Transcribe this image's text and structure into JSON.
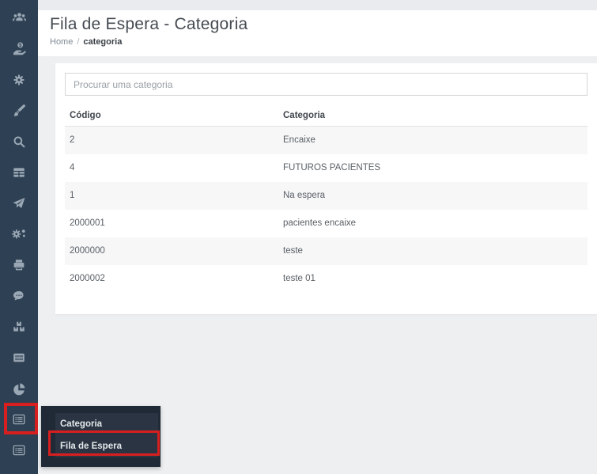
{
  "header": {
    "title": "Fila de Espera - Categoria",
    "breadcrumb": {
      "home": "Home",
      "separator": "/",
      "current": "categoria"
    }
  },
  "search": {
    "placeholder": "Procurar uma categoria",
    "value": ""
  },
  "table": {
    "columns": {
      "codigo": "Código",
      "categoria": "Categoria"
    },
    "rows": [
      {
        "codigo": "2",
        "categoria": "Encaixe"
      },
      {
        "codigo": "4",
        "categoria": "FUTUROS PACIENTES"
      },
      {
        "codigo": "1",
        "categoria": "Na espera"
      },
      {
        "codigo": "2000001",
        "categoria": "pacientes encaixe"
      },
      {
        "codigo": "2000000",
        "categoria": "teste"
      },
      {
        "codigo": "2000002",
        "categoria": "teste 01"
      }
    ]
  },
  "sidebar": {
    "items": [
      {
        "icon": "users-icon"
      },
      {
        "icon": "hand-holding-dollar-icon"
      },
      {
        "icon": "gear-icon"
      },
      {
        "icon": "paintbrush-icon"
      },
      {
        "icon": "search-icon"
      },
      {
        "icon": "table-icon"
      },
      {
        "icon": "paper-plane-icon"
      },
      {
        "icon": "gears-icon"
      },
      {
        "icon": "printer-icon"
      },
      {
        "icon": "chat-bubble-icon"
      },
      {
        "icon": "boxes-icon"
      },
      {
        "icon": "calendar-grid-icon"
      },
      {
        "icon": "pie-chart-icon"
      },
      {
        "icon": "list-icon"
      },
      {
        "icon": "list-icon"
      }
    ]
  },
  "submenu": {
    "items": [
      {
        "label": "Categoria"
      },
      {
        "label": "Fila de Espera"
      }
    ]
  },
  "colors": {
    "sidebar_bg": "#2e4053",
    "submenu_bg": "#1f2a36",
    "submenu_item_bg": "#2a3442",
    "highlight_red": "#d71f1f",
    "page_bg": "#edeff1",
    "stripe_row": "#f7f7f8"
  }
}
